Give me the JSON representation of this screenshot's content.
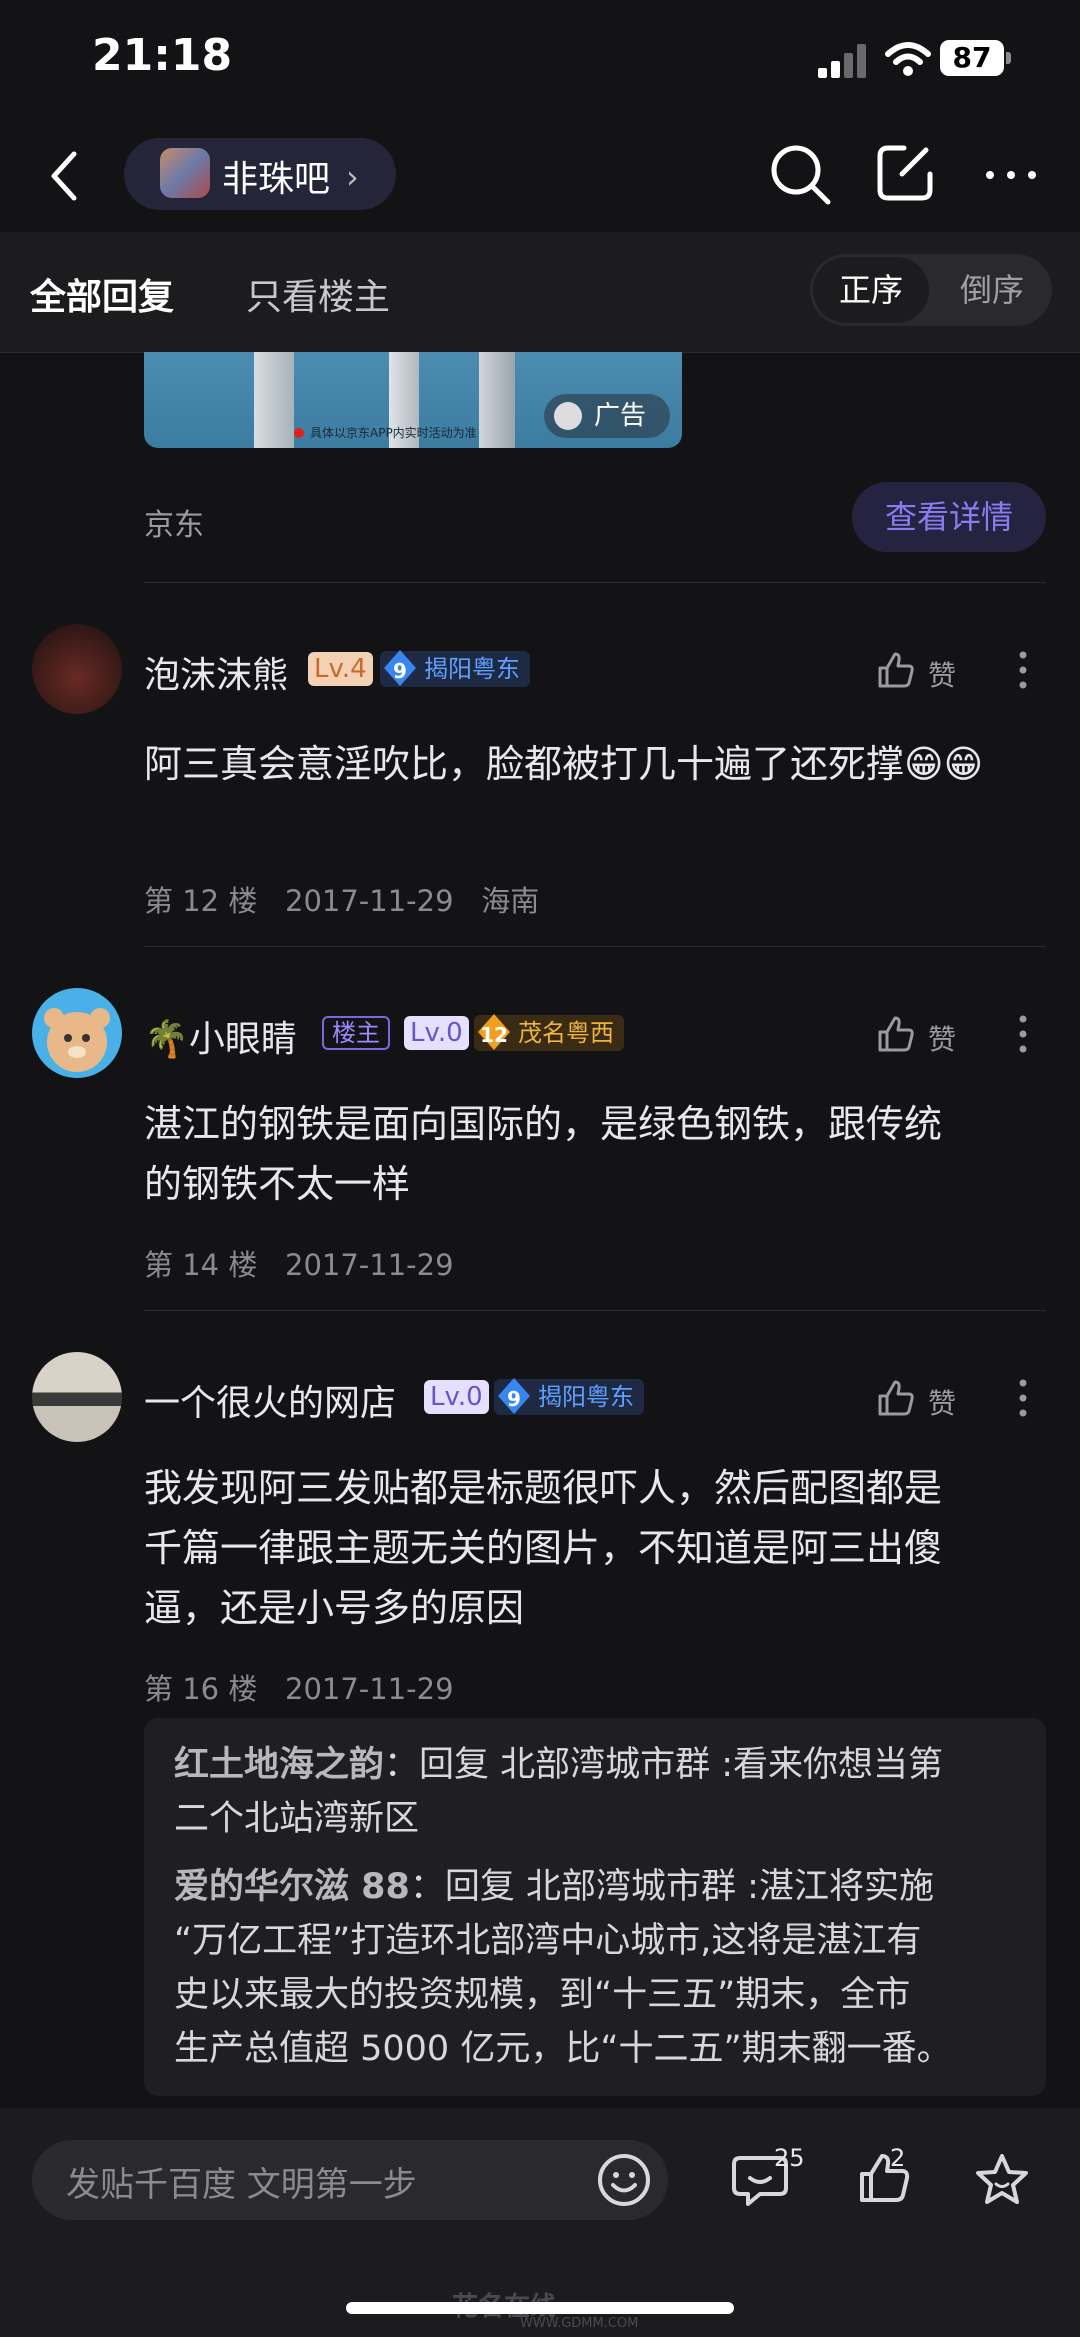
{
  "status": {
    "time": "21:18",
    "battery": "87"
  },
  "nav": {
    "forum_name": "非珠吧"
  },
  "tabs": {
    "all": "全部回复",
    "op_only": "只看楼主",
    "sort_asc": "正序",
    "sort_desc": "倒序"
  },
  "ad": {
    "badge": "广告",
    "source": "京东",
    "detail_button": "查看详情",
    "note": "具体以京东APP内实时活动为准"
  },
  "posts": [
    {
      "username": "泡沫沫熊",
      "level": "Lv.4",
      "place_level": "9",
      "place": "揭阳粤东",
      "like": "赞",
      "content": "阿三真会意淫吹比，脸都被打几十遍了还死撑😁😁",
      "floor": "第 12 楼",
      "date": "2017-11-29",
      "location": "海南"
    },
    {
      "username": "🌴小眼睛",
      "host_badge": "楼主",
      "level": "Lv.0",
      "place_level": "12",
      "place": "茂名粤西",
      "like": "赞",
      "content_line1": "湛江的钢铁是面向国际的，是绿色钢铁，跟传统",
      "content_line2": "的钢铁不太一样",
      "floor": "第 14 楼",
      "date": "2017-11-29"
    },
    {
      "username": "一个很火的网店",
      "level": "Lv.0",
      "place_level": "9",
      "place": "揭阳粤东",
      "like": "赞",
      "content_line1": "我发现阿三发贴都是标题很吓人，然后配图都是",
      "content_line2": "千篇一律跟主题无关的图片，不知道是阿三出傻",
      "content_line3": "逼，还是小号多的原因",
      "floor": "第 16 楼",
      "date": "2017-11-29"
    }
  ],
  "replies": [
    {
      "name": "红土地海之韵",
      "line1": "：回复 北部湾城市群 :看来你想当第",
      "line2": "二个北站湾新区"
    },
    {
      "name": "爱的华尔滋 88",
      "line1": "：回复 北部湾城市群 :湛江将实施",
      "line2": "“万亿工程”打造环北部湾中心城市,这将是湛江有",
      "line3": "史以来最大的投资规模，到“十三五”期末，全市",
      "line4": "生产总值超 5000 亿元，比“十二五”期末翻一番。"
    }
  ],
  "bottom": {
    "input_placeholder": "发贴千百度 文明第一步",
    "comment_count": "25",
    "like_count": "2"
  },
  "watermark": {
    "text": "花名在线",
    "url": "WWW.GDMM.COM"
  },
  "colors": {
    "background": "#131315",
    "accent": "#8a7cf0",
    "place_blue": "#5fa0ff",
    "place_gold": "#f0b43a"
  }
}
